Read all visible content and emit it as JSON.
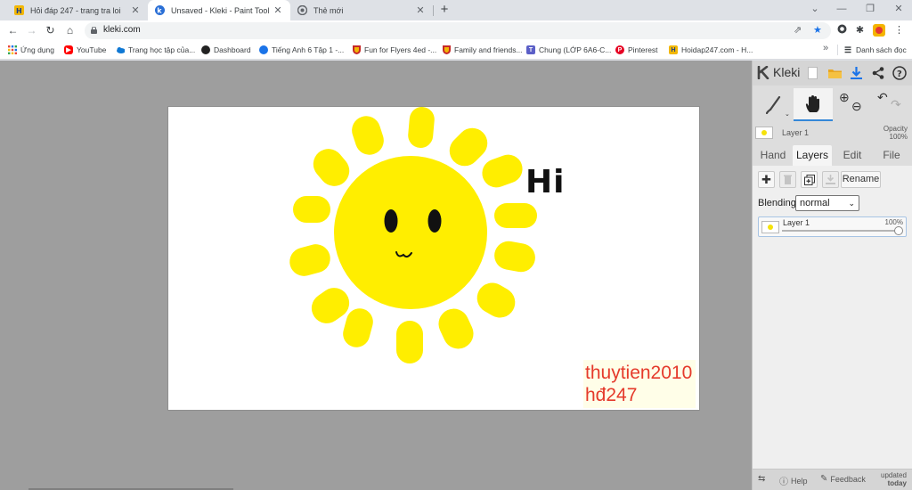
{
  "browser": {
    "tabs": [
      {
        "title": "Hỏi đáp 247 - trang tra loi",
        "active": false,
        "icon": "hoidap-favicon"
      },
      {
        "title": "Unsaved - Kleki - Paint Tool",
        "active": true,
        "icon": "kleki-favicon"
      },
      {
        "title": "Thẻ mới",
        "active": false,
        "icon": "chrome-favicon"
      }
    ],
    "new_tab_label": "+",
    "url": "kleki.com",
    "bookmarks": [
      {
        "label": "Ứng dụng",
        "icon": "apps-grid-icon",
        "color": "#e8453c"
      },
      {
        "label": "YouTube",
        "icon": "youtube-icon",
        "color": "#ff0000"
      },
      {
        "label": "Trang học tập của...",
        "icon": "onedrive-icon",
        "color": "#0f78d4"
      },
      {
        "label": "Dashboard",
        "icon": "dashboard-icon",
        "color": "#222222"
      },
      {
        "label": "Tiếng Anh 6 Tập 1 -...",
        "icon": "globe-icon",
        "color": "#1a73e8"
      },
      {
        "label": "Fun for Flyers 4ed -...",
        "icon": "shield-icon",
        "color": "#c62828"
      },
      {
        "label": "Family and friends...",
        "icon": "shield-icon",
        "color": "#c62828"
      },
      {
        "label": "Chung (LỚP 6A6-C...",
        "icon": "teams-icon",
        "color": "#5b5fc7"
      },
      {
        "label": "Pinterest",
        "icon": "pinterest-icon",
        "color": "#e60023"
      },
      {
        "label": "Hoidap247.com - H...",
        "icon": "hoidap-favicon",
        "color": "#f2b705"
      }
    ],
    "bookmarks_more": "»",
    "reading_list": "Danh sách đọc"
  },
  "canvas": {
    "drawing_text": "Hi",
    "watermark_line1": "thuytien2010",
    "watermark_line2": "hđ247",
    "sun_color": "#ffee00",
    "watermark_color": "#e53a2b"
  },
  "kleki": {
    "logo_text": "Kleki",
    "current_layer_name": "Layer 1",
    "opacity_label": "Opacity",
    "opacity_value": "100%",
    "tabs": [
      {
        "label": "Hand",
        "active": false
      },
      {
        "label": "Layers",
        "active": true
      },
      {
        "label": "Edit",
        "active": false
      },
      {
        "label": "File",
        "active": false
      }
    ],
    "rename_label": "Rename",
    "blending_label": "Blending",
    "blending_value": "normal",
    "layers": [
      {
        "name": "Layer 1",
        "opacity": "100%",
        "opacity_fraction": 1.0
      }
    ],
    "footer": {
      "help": "Help",
      "feedback": "Feedback",
      "updated_line1": "updated",
      "updated_line2": "today"
    },
    "accent_color": "#3487d8"
  }
}
